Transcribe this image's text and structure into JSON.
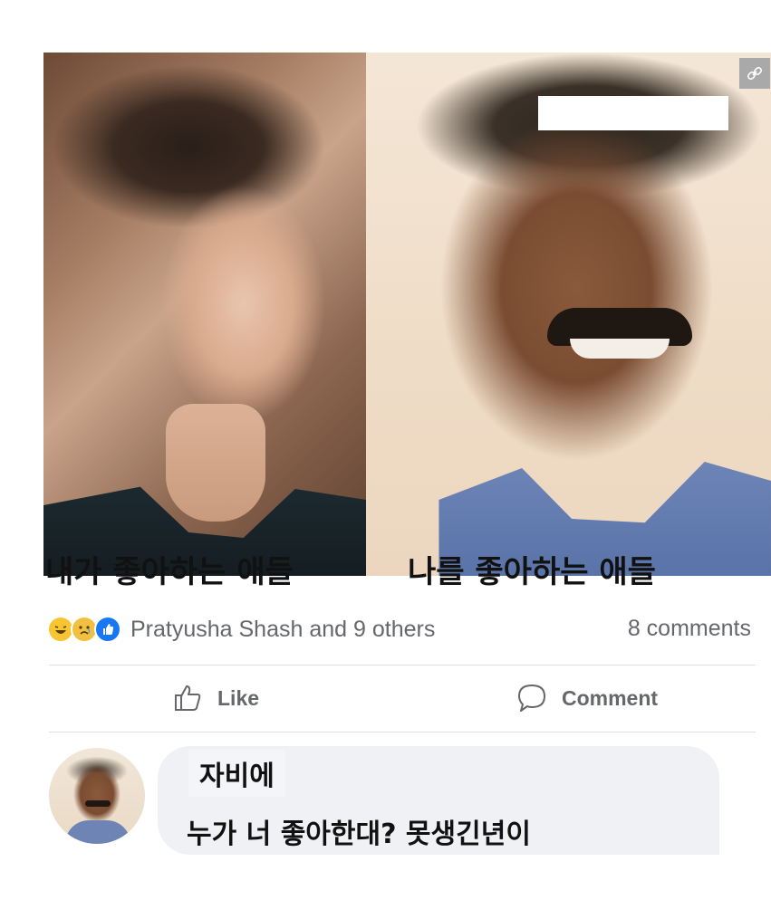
{
  "post": {
    "photos": [
      {
        "name": "photo-left",
        "icon": "young-man-portrait"
      },
      {
        "name": "photo-right",
        "icon": "smiling-man-portrait"
      }
    ],
    "link_icon": "link-icon",
    "captions": {
      "left": "내가 좋아하는 애들",
      "right": "나를 좋아하는 애들"
    },
    "reactions": {
      "icons": [
        "haha-icon",
        "sad-icon",
        "like-icon"
      ],
      "reactors": "Pratyusha Shash and 9 others",
      "comments_count": "8 comments"
    },
    "actions": {
      "like_label": "Like",
      "comment_label": "Comment"
    },
    "comment": {
      "author": "자비에",
      "text": "누가 너 좋아한대? 못생긴년이"
    },
    "colors": {
      "text_primary": "#111111",
      "text_secondary": "#65676b",
      "like_blue": "#1877f2",
      "reaction_yellow": "#f7c531",
      "bubble_bg": "#eff1f5",
      "divider": "#dcdfe3"
    }
  }
}
